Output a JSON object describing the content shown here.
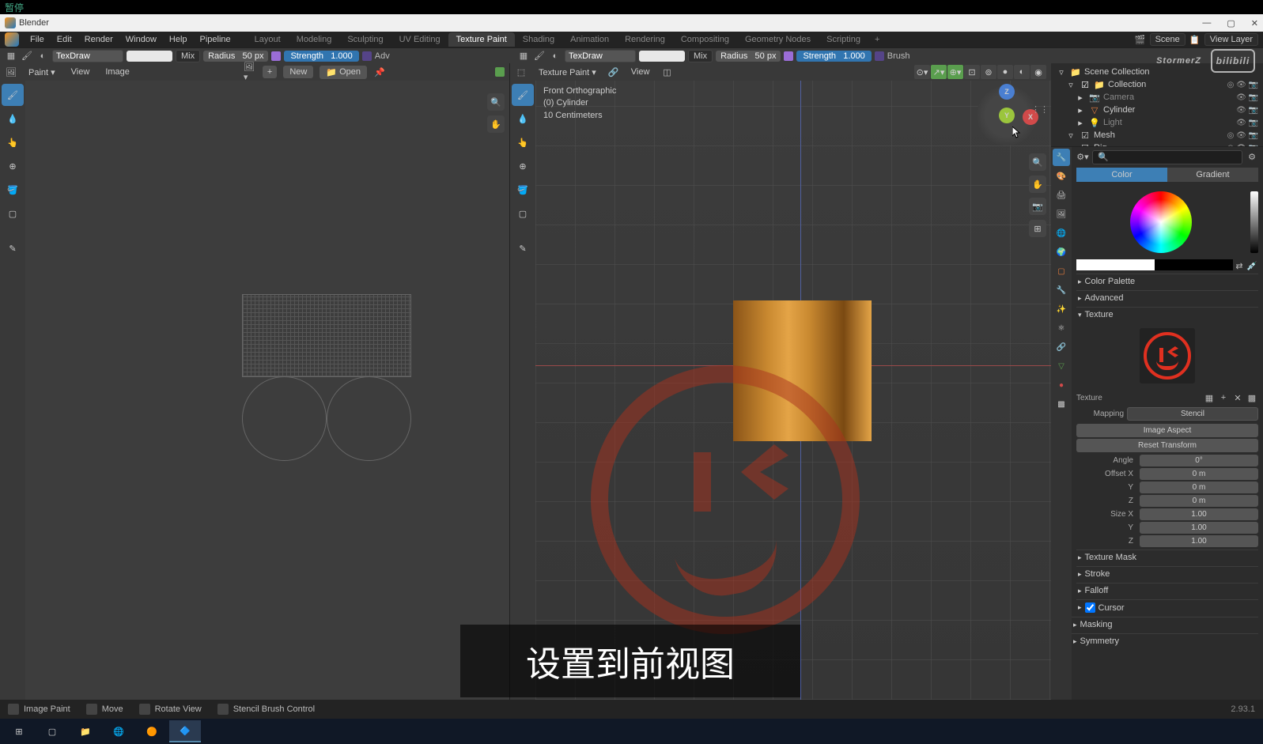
{
  "titlebar_chinese": "暂停",
  "app_name": "Blender",
  "menubar": [
    "File",
    "Edit",
    "Render",
    "Window",
    "Help",
    "Pipeline"
  ],
  "workspaces": [
    "Layout",
    "Modeling",
    "Sculpting",
    "UV Editing",
    "Texture Paint",
    "Shading",
    "Animation",
    "Rendering",
    "Compositing",
    "Geometry Nodes",
    "Scripting"
  ],
  "workspace_active": "Texture Paint",
  "scene": {
    "name": "Scene",
    "view_layer": "View Layer"
  },
  "toolbar_left": {
    "brush": "TexDraw",
    "blend": "Mix",
    "radius_label": "Radius",
    "radius": "50 px",
    "strength_label": "Strength",
    "strength": "1.000",
    "adv": "Adv"
  },
  "toolbar_right": {
    "brush": "TexDraw",
    "blend": "Mix",
    "radius_label": "Radius",
    "radius": "50 px",
    "strength_label": "Strength",
    "strength": "1.000",
    "brush_label": "Brush"
  },
  "left_editor": {
    "mode": "Paint",
    "menus": [
      "View",
      "Image"
    ],
    "new_btn": "New",
    "open_btn": "Open"
  },
  "viewport": {
    "mode": "Texture Paint",
    "menus": [
      "View"
    ],
    "info_line1": "Front Orthographic",
    "info_line2": "(0) Cylinder",
    "info_line3": "10 Centimeters"
  },
  "gizmo": {
    "x": "X",
    "y": "Y",
    "z": "Z"
  },
  "outliner": {
    "root": "Scene Collection",
    "collection": "Collection",
    "items": [
      "Camera",
      "Cylinder",
      "Light",
      "Mesh",
      "Rig"
    ]
  },
  "props": {
    "tab_color": "Color",
    "tab_gradient": "Gradient",
    "color_palette": "Color Palette",
    "advanced": "Advanced",
    "texture": "Texture",
    "texture_name": "Texture",
    "mapping_label": "Mapping",
    "mapping": "Stencil",
    "image_aspect": "Image Aspect",
    "reset_transform": "Reset Transform",
    "angle_label": "Angle",
    "angle": "0°",
    "offset_x_label": "Offset X",
    "offset_x": "0 m",
    "y_label": "Y",
    "offset_y": "0 m",
    "z_label": "Z",
    "offset_z": "0 m",
    "size_x_label": "Size X",
    "size_x": "1.00",
    "size_y": "1.00",
    "size_z": "1.00",
    "texture_mask": "Texture Mask",
    "stroke": "Stroke",
    "falloff": "Falloff",
    "cursor": "Cursor",
    "masking": "Masking",
    "symmetry": "Symmetry"
  },
  "status": {
    "image_paint": "Image Paint",
    "move": "Move",
    "rotate": "Rotate View",
    "stencil": "Stencil Brush Control",
    "version": "2.93.1"
  },
  "subtitle": "设置到前视图",
  "watermark": "StormerZ"
}
